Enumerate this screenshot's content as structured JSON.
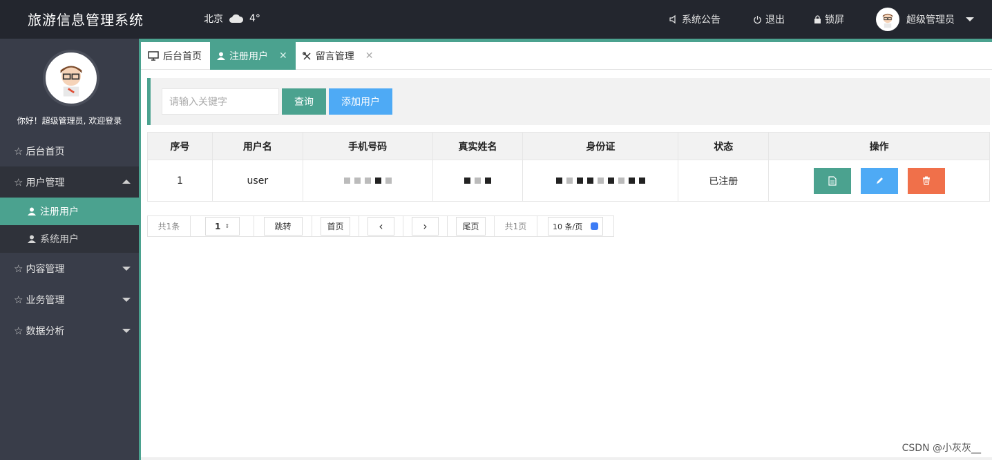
{
  "header": {
    "title": "旅游信息管理系统",
    "weather": {
      "city": "北京",
      "temp": "4°"
    },
    "announce_label": "系统公告",
    "logout_label": "退出",
    "lock_label": "锁屏",
    "user_name": "超级管理员"
  },
  "sidebar": {
    "welcome": "你好！超级管理员, 欢迎登录",
    "items": [
      {
        "label": "后台首页"
      },
      {
        "label": "用户管理"
      },
      {
        "label": "注册用户"
      },
      {
        "label": "系统用户"
      },
      {
        "label": "内容管理"
      },
      {
        "label": "业务管理"
      },
      {
        "label": "数据分析"
      }
    ]
  },
  "tabs": [
    {
      "label": "后台首页"
    },
    {
      "label": "注册用户"
    },
    {
      "label": "留言管理"
    }
  ],
  "toolbar": {
    "search_placeholder": "请输入关键字",
    "query_label": "查询",
    "add_label": "添加用户"
  },
  "table": {
    "headers": [
      "序号",
      "用户名",
      "手机号码",
      "真实姓名",
      "身份证",
      "状态",
      "操作"
    ],
    "rows": [
      {
        "index": "1",
        "username": "user",
        "status": "已注册"
      }
    ]
  },
  "pager": {
    "total": "共1条",
    "page_input": "1",
    "jump_label": "跳转",
    "first_label": "首页",
    "last_label": "尾页",
    "pages": "共1页",
    "page_size": "10 条/页"
  },
  "watermark": "CSDN @小灰灰__",
  "colors": {
    "accent": "#4ba28f",
    "blue": "#4eaaf5",
    "danger": "#f0704a",
    "header_bg": "#23262e",
    "sidebar_bg": "#393d49"
  }
}
